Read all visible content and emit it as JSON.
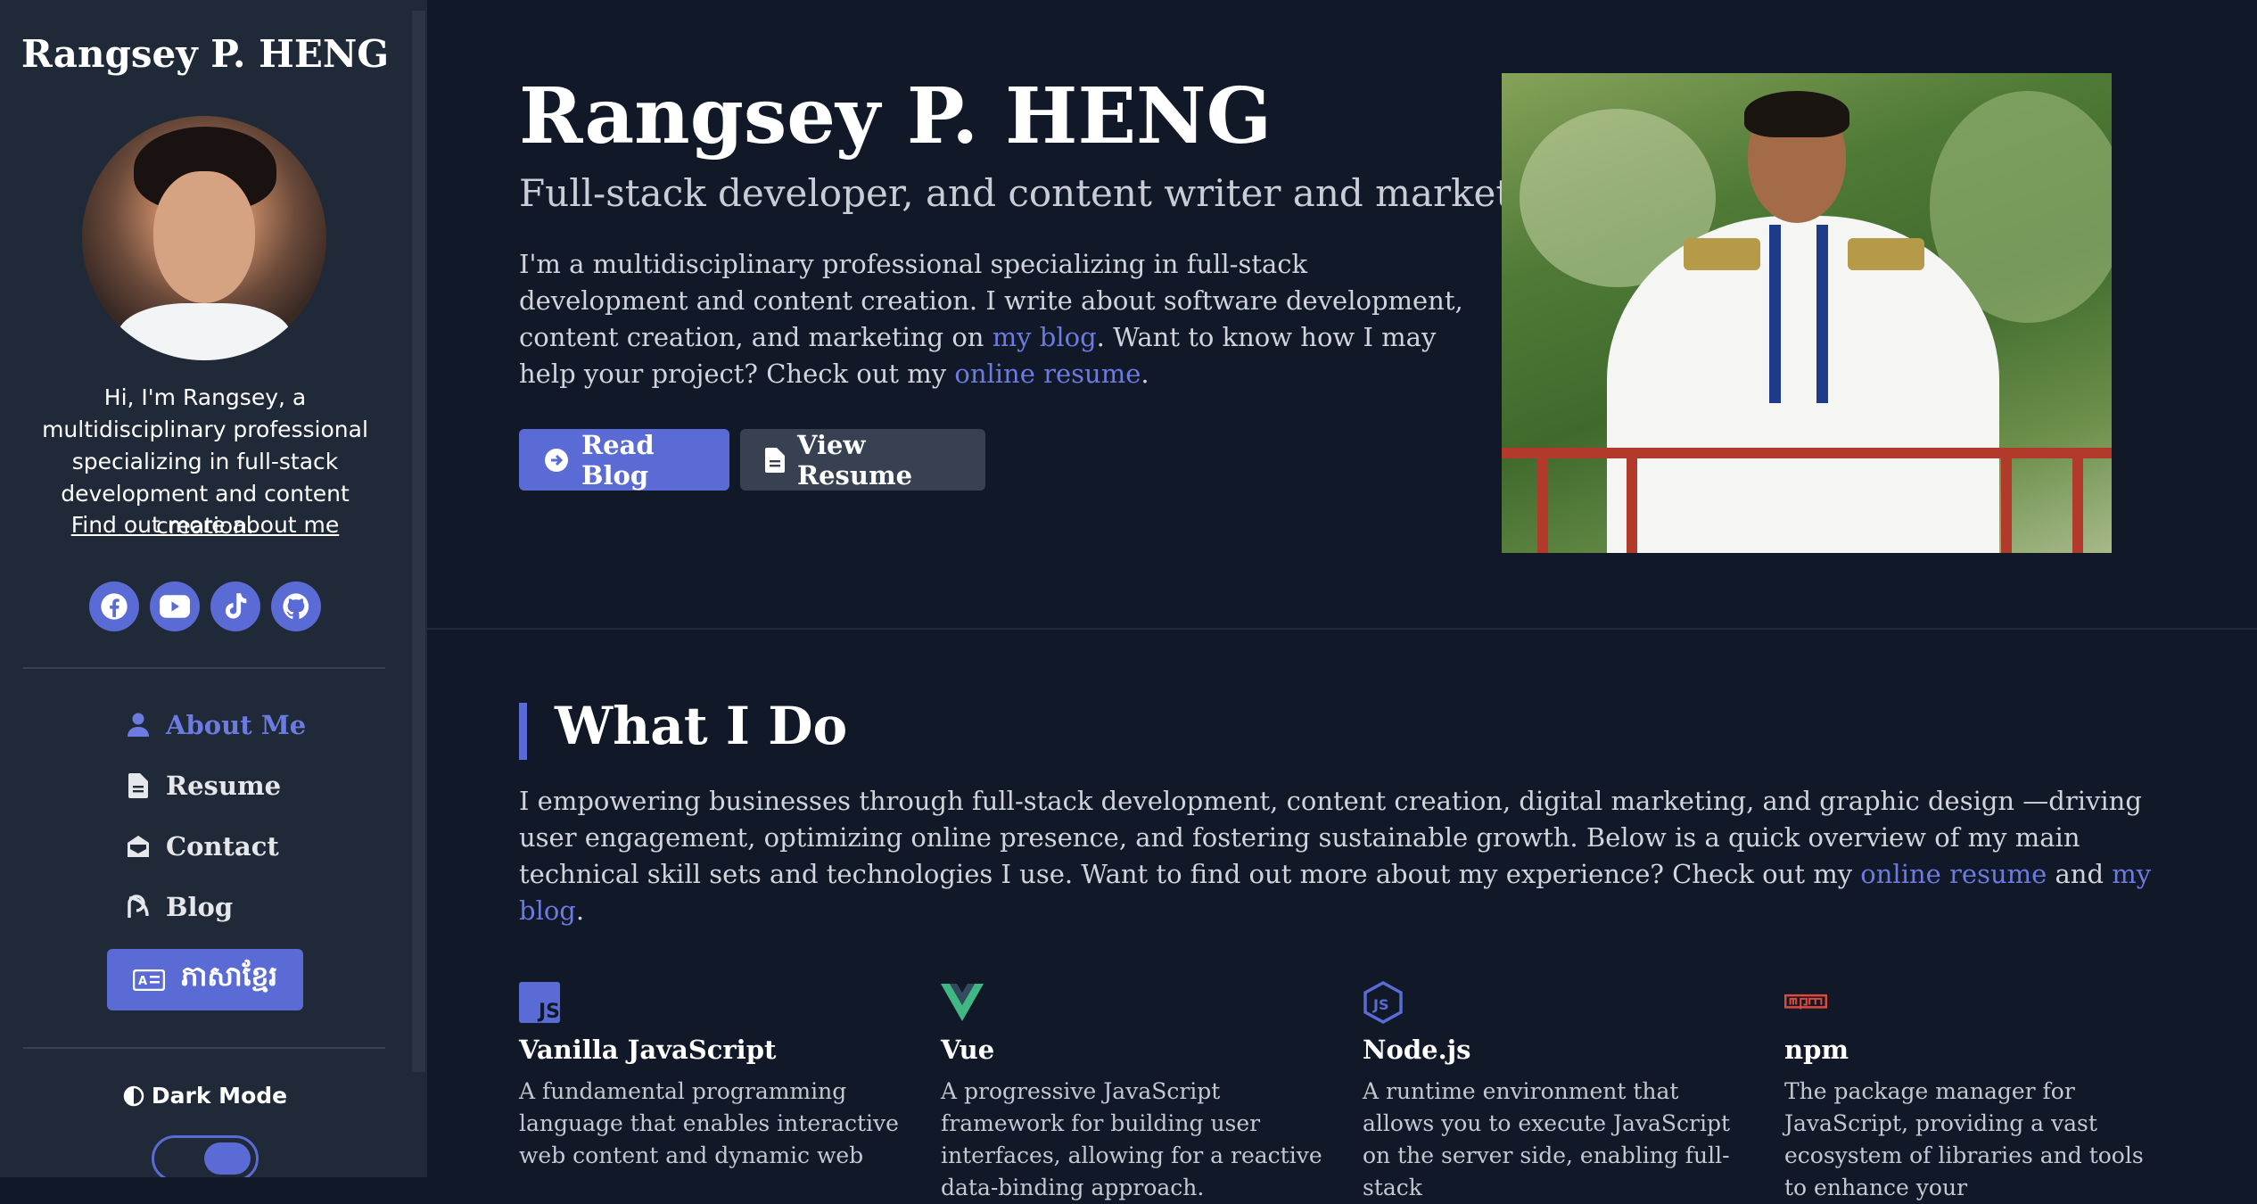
{
  "sidebar": {
    "name": "Rangsey P. HENG",
    "bio": "Hi, I'm Rangsey, a multidisciplinary professional specializing in full-stack development and content creation.",
    "bio_link": "Find out more about me",
    "social": [
      "facebook-icon",
      "youtube-icon",
      "tiktok-icon",
      "github-icon"
    ],
    "nav": [
      {
        "label": "About Me",
        "icon": "user-icon",
        "active": true
      },
      {
        "label": "Resume",
        "icon": "file-icon",
        "active": false
      },
      {
        "label": "Contact",
        "icon": "envelope-icon",
        "active": false
      },
      {
        "label": "Blog",
        "icon": "blog-icon",
        "active": false
      }
    ],
    "language_button": "ភាសាខ្មែរ",
    "dark_mode_label": "Dark Mode",
    "dark_mode_on": true
  },
  "hero": {
    "title": "Rangsey P. HENG",
    "subtitle": "Full-stack developer, and content writer and marketer",
    "desc_part1": "I'm a multidisciplinary professional specializing in full-stack development and content creation. I write about software development, content creation, and marketing on ",
    "desc_link1": "my blog",
    "desc_part2": ". Want to know how I may help your project? Check out my ",
    "desc_link2": "online resume",
    "desc_part3": ".",
    "btn_blog": "Read Blog",
    "btn_resume": "View Resume"
  },
  "what_i_do": {
    "title": "What I Do",
    "desc_part1": "I empowering businesses through full-stack development, content creation, digital marketing, and graphic design —driving user engagement, optimizing online presence, and fostering sustainable growth. Below is a quick overview of my main technical skill sets and technologies I use. Want to find out more about my experience? Check out my ",
    "desc_link1": "online resume",
    "desc_part2": " and ",
    "desc_link2": "my blog",
    "desc_part3": ".",
    "skills": [
      {
        "name": "Vanilla JavaScript",
        "icon": "javascript-icon",
        "desc": "A fundamental programming language that enables interactive web content and dynamic web"
      },
      {
        "name": "Vue",
        "icon": "vue-icon",
        "desc": "A progressive JavaScript framework for building user interfaces, allowing for a reactive data-binding approach."
      },
      {
        "name": "Node.js",
        "icon": "nodejs-icon",
        "desc": "A runtime environment that allows you to execute JavaScript on the server side, enabling full-stack"
      },
      {
        "name": "npm",
        "icon": "npm-icon",
        "desc": "The package manager for JavaScript, providing a vast ecosystem of libraries and tools to enhance your"
      }
    ]
  },
  "colors": {
    "accent": "#5b6bd5",
    "link": "#6b7be0",
    "background": "#111827",
    "sidebar": "#1f2937"
  }
}
